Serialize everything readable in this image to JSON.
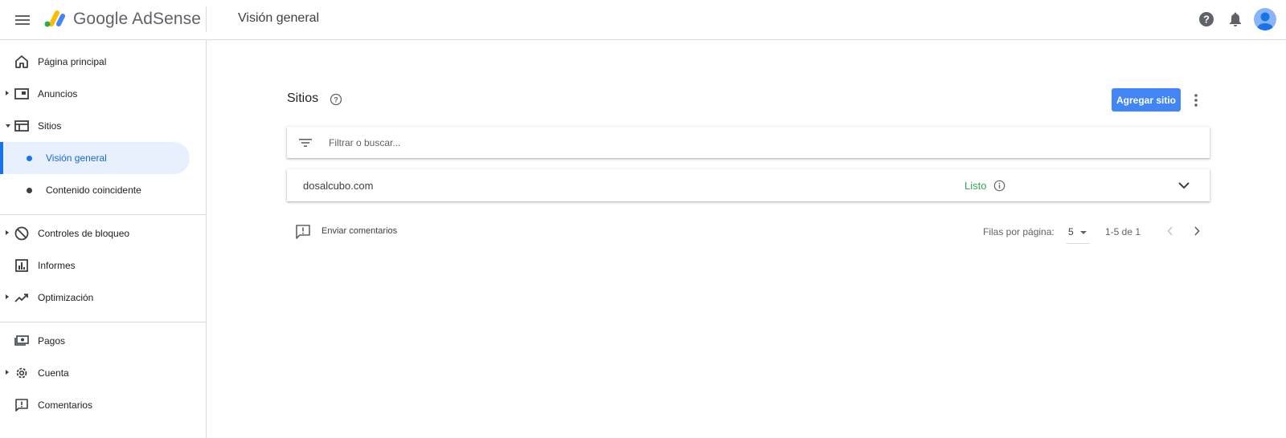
{
  "header": {
    "brand": "Google AdSense",
    "page_title": "Visión general",
    "icons": [
      "menu-icon",
      "adsense-logo",
      "help-icon",
      "notifications-icon",
      "account-avatar"
    ]
  },
  "sidebar": {
    "items": [
      {
        "label": "Página principal",
        "icon": "home-icon"
      },
      {
        "label": "Anuncios",
        "icon": "ads-icon"
      },
      {
        "label": "Sitios",
        "icon": "sites-icon"
      },
      {
        "label": "Visión general",
        "active": true
      },
      {
        "label": "Contenido coincidente"
      },
      {
        "label": "Controles de bloqueo",
        "icon": "block-icon"
      },
      {
        "label": "Informes",
        "icon": "reports-icon"
      },
      {
        "label": "Optimización",
        "icon": "trending-icon"
      },
      {
        "label": "Pagos",
        "icon": "payments-icon"
      },
      {
        "label": "Cuenta",
        "icon": "settings-icon"
      },
      {
        "label": "Comentarios",
        "icon": "feedback-icon"
      }
    ]
  },
  "main": {
    "section_title": "Sitios",
    "add_button": "Agregar sitio",
    "filter_placeholder": "Filtrar o buscar...",
    "sites": [
      {
        "domain": "dosalcubo.com",
        "status": "Listo"
      }
    ],
    "feedback_label": "Enviar comentarios",
    "pagination": {
      "rows_label": "Filas por página:",
      "rows_value": "5",
      "range": "1-5 de 1"
    }
  },
  "colors": {
    "accent": "#1a73e8",
    "button": "#4285f4",
    "status_ready": "#34a853",
    "active_bg": "#e8f0fe"
  }
}
